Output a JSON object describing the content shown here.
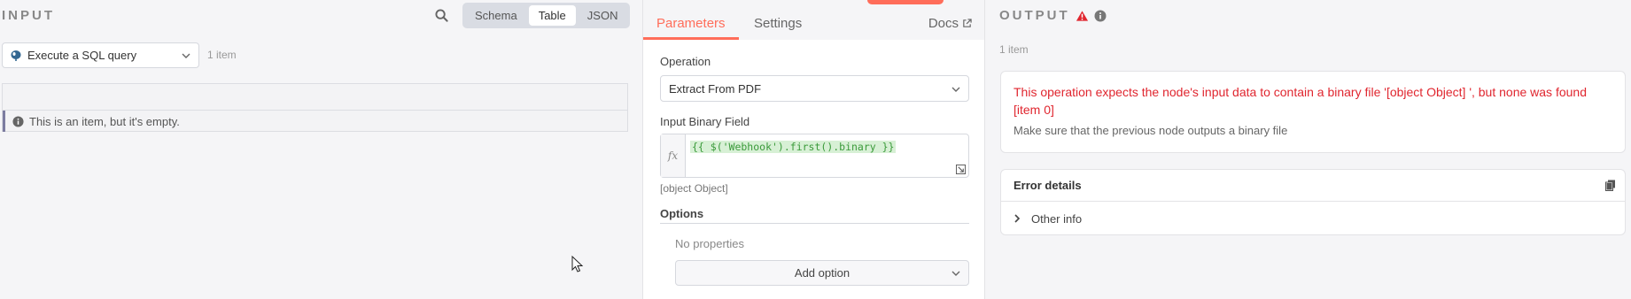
{
  "input": {
    "title": "INPUT",
    "view_modes": [
      "Schema",
      "Table",
      "JSON"
    ],
    "active_view": "Table",
    "node_select": "Execute a SQL query",
    "item_count": "1 item",
    "empty_message": "This is an item, but it's empty."
  },
  "params": {
    "tabs": {
      "parameters": "Parameters",
      "settings": "Settings",
      "docs": "Docs"
    },
    "operation_label": "Operation",
    "operation_value": "Extract From PDF",
    "binary_field_label": "Input Binary Field",
    "fx_label": "fx",
    "expression": "{{ $('Webhook').first().binary }}",
    "expression_result": "[object Object]",
    "options_label": "Options",
    "no_properties": "No properties",
    "add_option": "Add option"
  },
  "output": {
    "title": "OUTPUT",
    "item_count": "1 item",
    "error_message": "This operation expects the node's input data to contain a binary file '[object Object] ', but none was found [item 0]",
    "error_hint": "Make sure that the previous node outputs a binary file",
    "error_details_label": "Error details",
    "other_info_label": "Other info"
  },
  "colors": {
    "accent": "#ff6d5a",
    "error": "#e0262f",
    "expression_green": "#3a9a3a"
  },
  "icons": {
    "search": "search-icon",
    "database": "postgres-icon",
    "warning": "warning-triangle-icon",
    "info": "info-icon",
    "external": "external-link-icon",
    "copy": "copy-icon",
    "expand": "expand-icon"
  }
}
